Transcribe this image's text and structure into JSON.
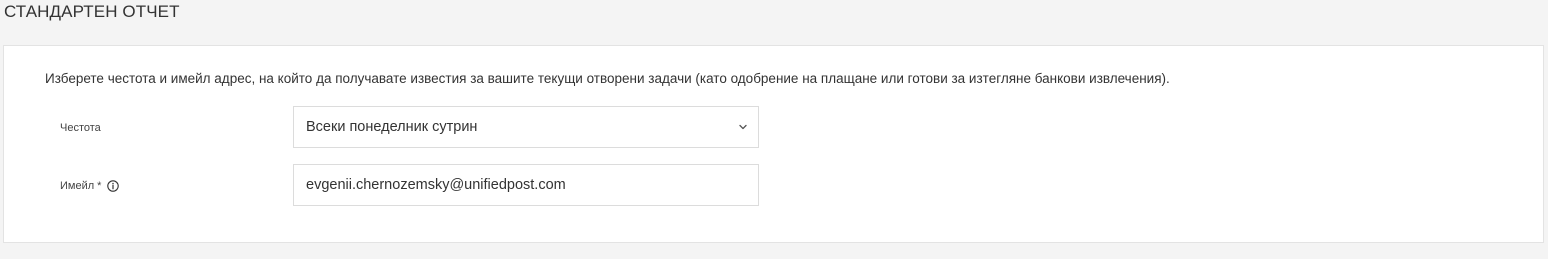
{
  "page": {
    "title": "СТАНДАРТЕН ОТЧЕТ"
  },
  "form": {
    "description": "Изберете честота и имейл адрес, на който да получавате известия за вашите текущи отворени задачи (като одобрение на плащане или готови за изтегляне банкови извлечения).",
    "frequency": {
      "label": "Честота",
      "selected_value": "Всеки понеделник сутрин",
      "icon": "chevron-down-icon"
    },
    "email": {
      "label": "Имейл",
      "required_marker": "*",
      "value": "evgenii.chernozemsky@unifiedpost.com",
      "icon": "info-icon"
    }
  },
  "colors": {
    "background": "#f4f4f4",
    "card": "#ffffff",
    "border": "#dcdcdc",
    "text": "#333333"
  }
}
